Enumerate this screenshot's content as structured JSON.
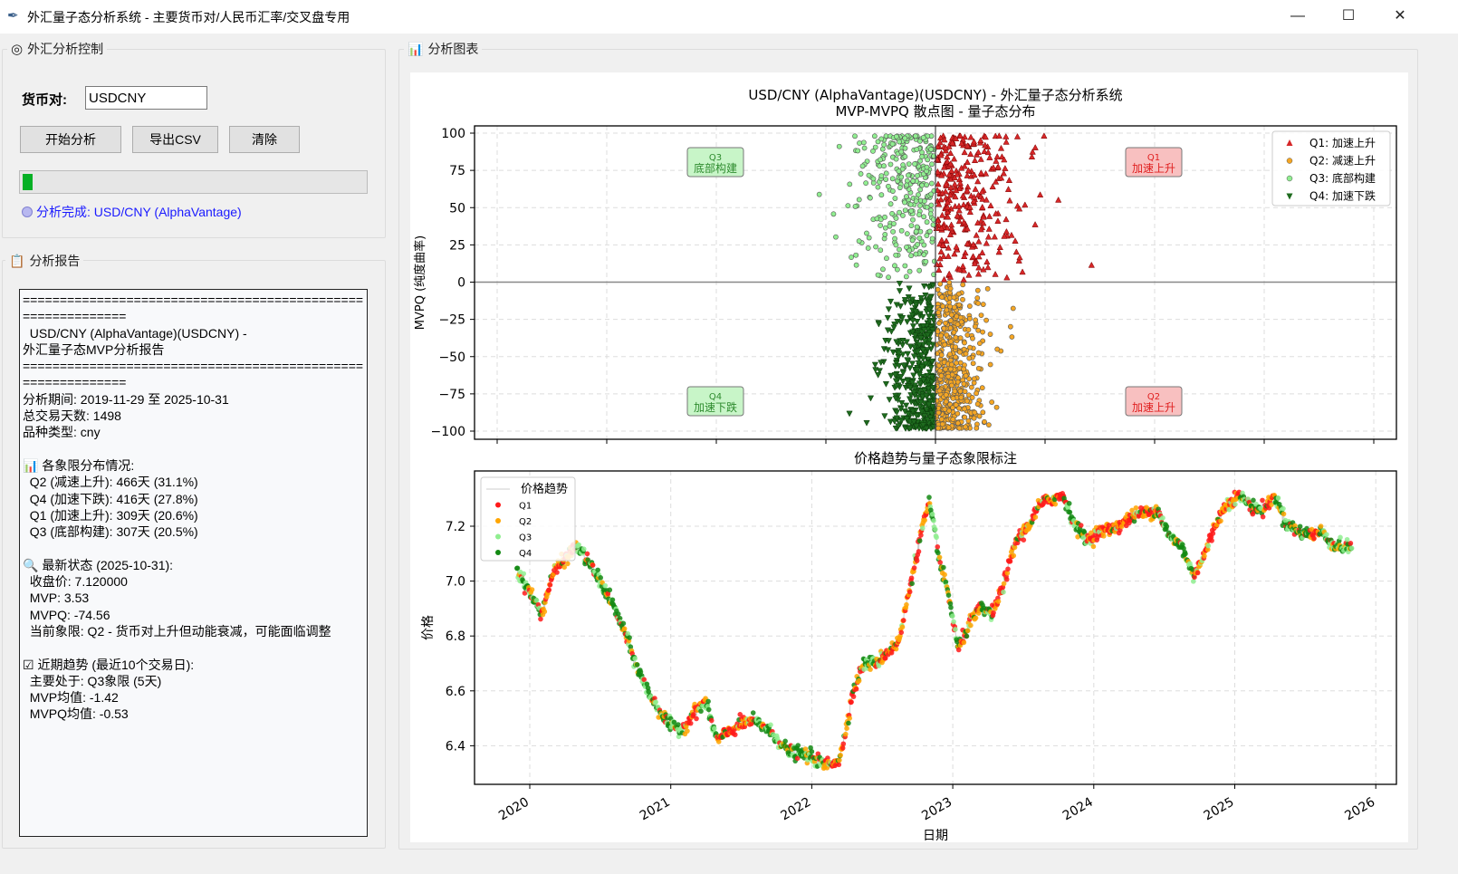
{
  "window": {
    "title": "外汇量子态分析系统 - 主要货币对/人民币汇率/交叉盘专用",
    "minimize": "—",
    "maximize": "☐",
    "close": "✕"
  },
  "control": {
    "frame_title": "外汇分析控制",
    "pair_label": "货币对:",
    "pair_value": "USDCNY",
    "start_button": "开始分析",
    "export_button": "导出CSV",
    "clear_button": "清除",
    "progress_percent": 3,
    "status_text": "分析完成: USD/CNY (AlphaVantage)"
  },
  "report": {
    "frame_title": "分析报告",
    "lines": [
      "============================================================",
      "  USD/CNY (AlphaVantage)(USDCNY) -",
      "外汇量子态MVP分析报告",
      "============================================================",
      "分析期间: 2019-11-29 至 2025-10-31",
      "总交易天数: 1498",
      "品种类型: cny",
      "",
      "📊 各象限分布情况:",
      "  Q2 (减速上升): 466天 (31.1%)",
      "  Q4 (加速下跌): 416天 (27.8%)",
      "  Q1 (加速上升): 309天 (20.6%)",
      "  Q3 (底部构建): 307天 (20.5%)",
      "",
      "🔍 最新状态 (2025-10-31):",
      "  收盘价: 7.120000",
      "  MVP: 3.53",
      "  MVPQ: -74.56",
      "  当前象限: Q2 - 货币对上升但动能衰减，可能面临调整",
      "",
      "☑ 近期趋势 (最近10个交易日):",
      "  主要处于: Q3象限 (5天)",
      "  MVP均值: -1.42",
      "  MVPQ均值: -0.53"
    ]
  },
  "charts": {
    "frame_title": "分析图表"
  },
  "chart_data": [
    {
      "type": "scatter",
      "title": "USD/CNY (AlphaVantage)(USDCNY) - 外汇量子态分析系统",
      "subtitle": "MVP-MVPQ 散点图 - 量子态分布",
      "xlabel": "",
      "ylabel": "MVPQ (纯度曲率)",
      "ylim": [
        -100,
        100
      ],
      "yticks": [
        "100",
        "75",
        "50",
        "25",
        "0",
        "−25",
        "−50",
        "−75",
        "−100"
      ],
      "grid": true,
      "legend_position": "top-right",
      "series": [
        {
          "name": "Q1: 加速上升",
          "count": 309,
          "marker": "triangle-up",
          "color": "#d62728",
          "quadrant": "x>0,y>0"
        },
        {
          "name": "Q2: 减速上升",
          "count": 466,
          "marker": "circle",
          "color": "#f5a623",
          "quadrant": "x>0,y<0"
        },
        {
          "name": "Q3: 底部构建",
          "count": 307,
          "marker": "circle",
          "color": "#90ee90",
          "quadrant": "x<0,y>0"
        },
        {
          "name": "Q4: 加速下跌",
          "count": 416,
          "marker": "triangle-down",
          "color": "#1e6b1e",
          "quadrant": "x<0,y<0"
        }
      ],
      "quadrant_labels": [
        {
          "code": "Q3",
          "text": "底部构建",
          "color": "#2e8b2e",
          "bg": "#c8f5c8"
        },
        {
          "code": "Q1",
          "text": "加速上升",
          "color": "#e02020",
          "bg": "#f8c0c0"
        },
        {
          "code": "Q4",
          "text": "加速下跌",
          "color": "#2e8b2e",
          "bg": "#c8f5c8"
        },
        {
          "code": "Q2",
          "text": "加速上升",
          "color": "#e02020",
          "bg": "#f8c0c0"
        }
      ]
    },
    {
      "type": "scatter",
      "title": "价格趋势与量子态象限标注",
      "xlabel": "日期",
      "ylabel": "价格",
      "xticks": [
        "2020",
        "2021",
        "2022",
        "2023",
        "2024",
        "2025",
        "2026"
      ],
      "yticks": [
        "7.2",
        "7.0",
        "6.8",
        "6.6",
        "6.4"
      ],
      "ylim": [
        6.3,
        7.35
      ],
      "grid": true,
      "legend_position": "top-left",
      "legend": [
        "价格趋势",
        "Q1",
        "Q2",
        "Q3",
        "Q4"
      ],
      "colors": {
        "line": "#cccccc",
        "Q1": "#ff1a1a",
        "Q2": "#ffa500",
        "Q3": "#90ee90",
        "Q4": "#138a13"
      },
      "price_points": [
        [
          "2019-11-29",
          7.04
        ],
        [
          "2020-01-01",
          6.96
        ],
        [
          "2020-02-01",
          6.88
        ],
        [
          "2020-03-01",
          7.03
        ],
        [
          "2020-04-01",
          7.08
        ],
        [
          "2020-05-01",
          7.13
        ],
        [
          "2020-06-01",
          7.07
        ],
        [
          "2020-07-01",
          7.0
        ],
        [
          "2020-08-01",
          6.92
        ],
        [
          "2020-09-01",
          6.82
        ],
        [
          "2020-10-01",
          6.7
        ],
        [
          "2020-11-01",
          6.6
        ],
        [
          "2020-12-01",
          6.53
        ],
        [
          "2021-01-01",
          6.47
        ],
        [
          "2021-02-01",
          6.46
        ],
        [
          "2021-03-01",
          6.52
        ],
        [
          "2021-04-01",
          6.56
        ],
        [
          "2021-05-01",
          6.42
        ],
        [
          "2021-06-01",
          6.45
        ],
        [
          "2021-07-01",
          6.48
        ],
        [
          "2021-08-01",
          6.49
        ],
        [
          "2021-09-01",
          6.47
        ],
        [
          "2021-10-01",
          6.43
        ],
        [
          "2021-11-01",
          6.38
        ],
        [
          "2021-12-01",
          6.37
        ],
        [
          "2022-01-01",
          6.36
        ],
        [
          "2022-02-01",
          6.33
        ],
        [
          "2022-03-15",
          6.35
        ],
        [
          "2022-04-15",
          6.58
        ],
        [
          "2022-05-15",
          6.7
        ],
        [
          "2022-06-15",
          6.7
        ],
        [
          "2022-07-15",
          6.74
        ],
        [
          "2022-08-15",
          6.78
        ],
        [
          "2022-09-15",
          7.0
        ],
        [
          "2022-10-15",
          7.2
        ],
        [
          "2022-11-01",
          7.28
        ],
        [
          "2022-11-20",
          7.15
        ],
        [
          "2022-12-01",
          7.05
        ],
        [
          "2022-12-20",
          6.96
        ],
        [
          "2023-01-15",
          6.75
        ],
        [
          "2023-02-15",
          6.85
        ],
        [
          "2023-03-15",
          6.9
        ],
        [
          "2023-04-15",
          6.88
        ],
        [
          "2023-05-15",
          7.0
        ],
        [
          "2023-06-15",
          7.15
        ],
        [
          "2023-07-15",
          7.2
        ],
        [
          "2023-08-15",
          7.28
        ],
        [
          "2023-09-15",
          7.3
        ],
        [
          "2023-10-15",
          7.31
        ],
        [
          "2023-11-15",
          7.2
        ],
        [
          "2023-12-15",
          7.15
        ],
        [
          "2024-01-15",
          7.18
        ],
        [
          "2024-02-15",
          7.19
        ],
        [
          "2024-03-15",
          7.21
        ],
        [
          "2024-04-15",
          7.24
        ],
        [
          "2024-05-15",
          7.25
        ],
        [
          "2024-06-15",
          7.26
        ],
        [
          "2024-07-15",
          7.16
        ],
        [
          "2024-08-15",
          7.13
        ],
        [
          "2024-09-15",
          7.02
        ],
        [
          "2024-10-15",
          7.1
        ],
        [
          "2024-11-15",
          7.22
        ],
        [
          "2024-12-15",
          7.29
        ],
        [
          "2025-01-15",
          7.31
        ],
        [
          "2025-02-15",
          7.27
        ],
        [
          "2025-03-15",
          7.26
        ],
        [
          "2025-04-15",
          7.31
        ],
        [
          "2025-05-15",
          7.21
        ],
        [
          "2025-06-15",
          7.18
        ],
        [
          "2025-07-15",
          7.17
        ],
        [
          "2025-08-15",
          7.18
        ],
        [
          "2025-09-15",
          7.13
        ],
        [
          "2025-10-31",
          7.12
        ]
      ]
    }
  ]
}
